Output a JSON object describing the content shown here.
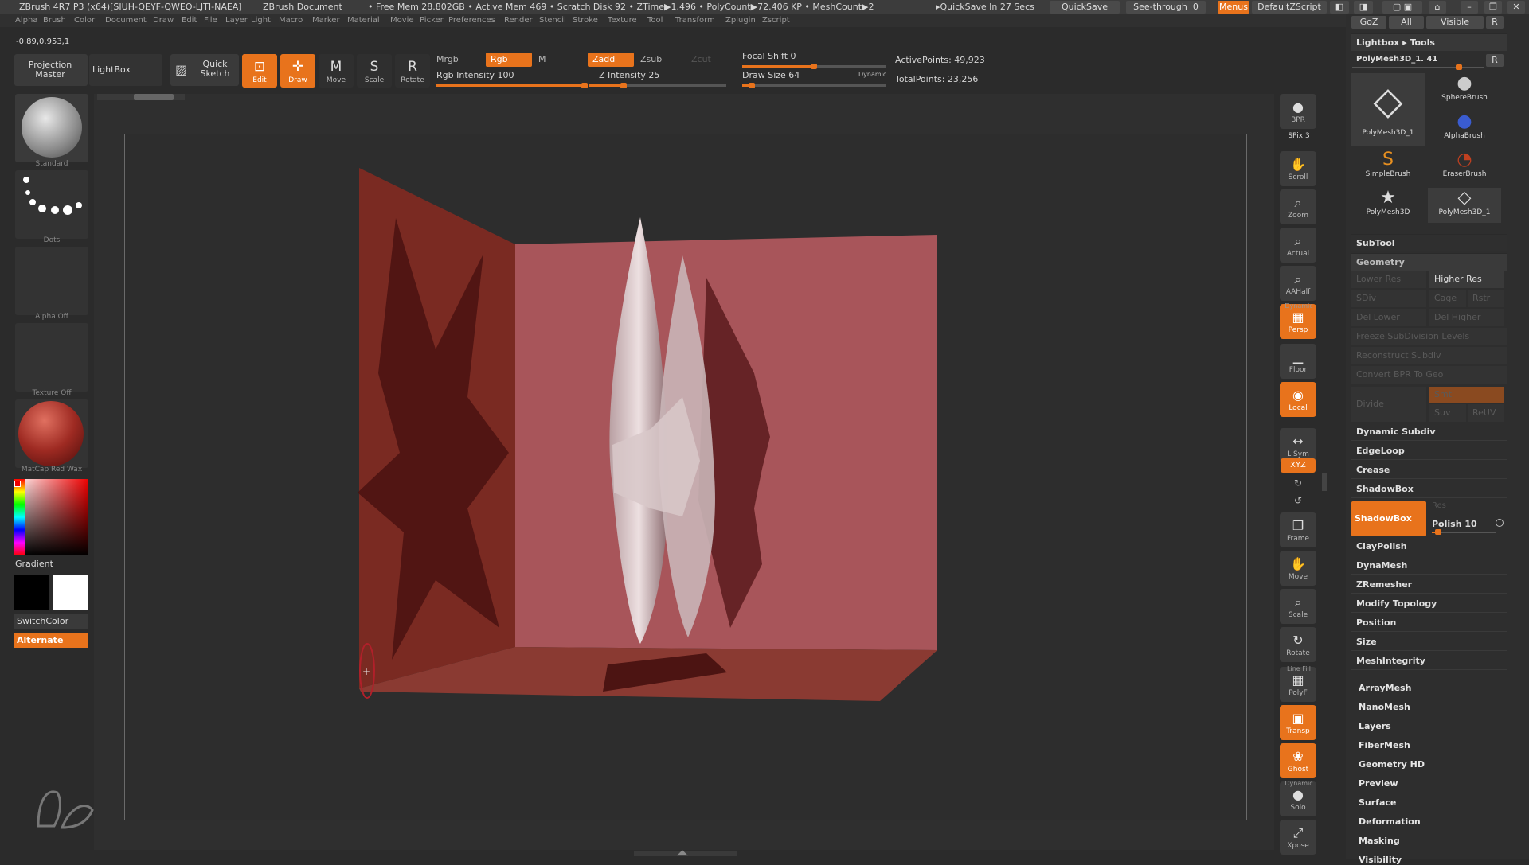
{
  "titlebar": {
    "app": "ZBrush 4R7 P3 (x64)[SIUH-QEYF-QWEO-LJTI-NAEA]",
    "doc": "ZBrush Document",
    "stats": "• Free Mem 28.802GB • Active Mem 469 • Scratch Disk 92 • ZTime▶1.496 • PolyCount▶72.406 KP • MeshCount▶2",
    "quicksave_status": "▸QuickSave In 27 Secs",
    "quicksave_btn": "QuickSave",
    "seethrough": "See-through",
    "seethrough_val": "0",
    "menus_btn": "Menus",
    "script_btn": "DefaultZScript"
  },
  "menubar": [
    "Alpha",
    "Brush",
    "Color",
    "Document",
    "Draw",
    "Edit",
    "File",
    "Layer",
    "Light",
    "Macro",
    "Marker",
    "Material",
    "Movie",
    "Picker",
    "Preferences",
    "Render",
    "Stencil",
    "Stroke",
    "Texture",
    "Tool",
    "Transform",
    "Zplugin",
    "Zscript"
  ],
  "coords": "-0.89,0.953,1",
  "toolbar": {
    "projection_master": "Projection Master",
    "lightbox": "LightBox",
    "quick_sketch": "Quick Sketch",
    "edit": "Edit",
    "draw": "Draw",
    "move": "Move",
    "scale": "Scale",
    "rotate": "Rotate",
    "mrgb": "Mrgb",
    "rgb": "Rgb",
    "m": "M",
    "zadd": "Zadd",
    "zsub": "Zsub",
    "zcut": "Zcut",
    "rgb_intensity": "Rgb Intensity 100",
    "z_intensity": "Z Intensity 25",
    "focal_shift": "Focal Shift 0",
    "draw_size": "Draw Size 64",
    "dynamic": "Dynamic",
    "active_points": "ActivePoints: 49,923",
    "total_points": "TotalPoints: 23,256",
    "rgb_intensity_value": 100,
    "z_intensity_value": 25,
    "focal_shift_value": 0,
    "draw_size_value": 64
  },
  "left_shelf": {
    "brush_caption": "Standard",
    "stroke_caption": "Dots",
    "alpha_caption": "Alpha Off",
    "texture_caption": "Texture Off",
    "material_caption": "MatCap Red Wax",
    "gradient": "Gradient",
    "switch_color": "SwitchColor",
    "alternate": "Alternate"
  },
  "right_shelf": [
    {
      "name": "bpr",
      "label": "BPR",
      "icon": "●"
    },
    {
      "name": "spix",
      "label": "SPix 3",
      "icon": ""
    },
    {
      "name": "scroll",
      "label": "Scroll",
      "icon": "✋"
    },
    {
      "name": "zoom",
      "label": "Zoom",
      "icon": "⌕"
    },
    {
      "name": "actual",
      "label": "Actual",
      "icon": "⌕"
    },
    {
      "name": "aahalf",
      "label": "AAHalf",
      "icon": "⌕"
    },
    {
      "name": "persp",
      "label": "Persp",
      "icon": "▦"
    },
    {
      "name": "floor",
      "label": "Floor",
      "icon": "▁"
    },
    {
      "name": "local",
      "label": "Local",
      "icon": "◉"
    },
    {
      "name": "lsym",
      "label": "L.Sym",
      "icon": "↔"
    },
    {
      "name": "xyz",
      "label": "XYZ",
      "icon": "↻"
    },
    {
      "name": "frame",
      "label": "Frame",
      "icon": "❐"
    },
    {
      "name": "move",
      "label": "Move",
      "icon": "✋"
    },
    {
      "name": "scale",
      "label": "Scale",
      "icon": "⌕"
    },
    {
      "name": "rotate",
      "label": "Rotate",
      "icon": "↻"
    },
    {
      "name": "polyf",
      "label": "PolyF",
      "icon": "▦"
    },
    {
      "name": "transp",
      "label": "Transp",
      "icon": "▣"
    },
    {
      "name": "ghost",
      "label": "Ghost",
      "icon": "❀"
    },
    {
      "name": "solo",
      "label": "Solo",
      "icon": "●"
    },
    {
      "name": "xpose",
      "label": "Xpose",
      "icon": "⤢"
    }
  ],
  "right_shelf_extra": {
    "dynamic_tag": "Dynamic",
    "linefill": "Line Fill",
    "dynamic_tag2": "Dynamic"
  },
  "panel": {
    "goz": "GoZ",
    "all": "All",
    "visible": "Visible",
    "r": "R",
    "lightbox_tools": "Lightbox ▸ Tools",
    "polymesh_name": "PolyMesh3D_1. 41",
    "tools": [
      {
        "label": "PolyMesh3D_1",
        "icon": "◇"
      },
      {
        "label": "SphereBrush",
        "icon": "●"
      },
      {
        "label": "AlphaBrush",
        "icon": "●"
      },
      {
        "label": "SimpleBrush",
        "icon": "S"
      },
      {
        "label": "EraserBrush",
        "icon": "◔"
      },
      {
        "label": "PolyMesh3D",
        "icon": "★"
      },
      {
        "label": "PolyMesh3D_1",
        "icon": "◇"
      }
    ],
    "subtool": "SubTool",
    "geometry": "Geometry",
    "lower_res": "Lower Res",
    "higher_res": "Higher Res",
    "sdiv": "SDiv",
    "cage": "Cage",
    "rstr": "Rstr",
    "del_lower": "Del Lower",
    "del_higher": "Del Higher",
    "freeze": "Freeze SubDivision Levels",
    "reconstruct": "Reconstruct Subdiv",
    "convert_bpr": "Convert BPR To Geo",
    "divide": "Divide",
    "smt": "Smt",
    "suv": "Suv",
    "reuv": "ReUV",
    "items": [
      "Dynamic Subdiv",
      "EdgeLoop",
      "Crease",
      "ShadowBox"
    ],
    "shadowbox_btn": "ShadowBox",
    "res": "Res",
    "polish": "Polish 10",
    "polish_value": 10,
    "items2": [
      "ClayPolish",
      "DynaMesh",
      "ZRemesher",
      "Modify Topology",
      "Position",
      "Size",
      "MeshIntegrity"
    ],
    "sections": [
      "ArrayMesh",
      "NanoMesh",
      "Layers",
      "FiberMesh",
      "Geometry HD",
      "Preview",
      "Surface",
      "Deformation",
      "Masking",
      "Visibility"
    ]
  }
}
